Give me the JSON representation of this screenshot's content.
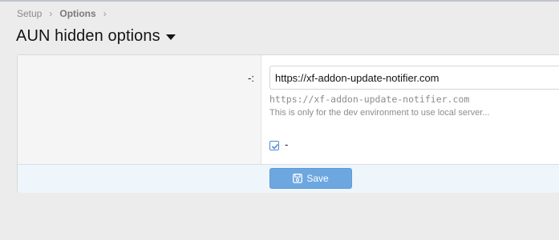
{
  "breadcrumb": {
    "items": [
      "Setup",
      "Options"
    ]
  },
  "page": {
    "title": "AUN hidden options"
  },
  "option": {
    "label": "-:",
    "value": "https://xf-addon-update-notifier.com",
    "default_hint": "https://xf-addon-update-notifier.com",
    "explain": "This is only for the dev environment to use local server...",
    "checkbox_label": "-",
    "checkbox_checked": true
  },
  "submit": {
    "save_label": "Save"
  },
  "colors": {
    "accent": "#6da7e0",
    "submit_row": "#eef5fb"
  },
  "icons": {
    "save": "save-icon",
    "caret": "caret-down-icon",
    "check": "check-icon"
  }
}
